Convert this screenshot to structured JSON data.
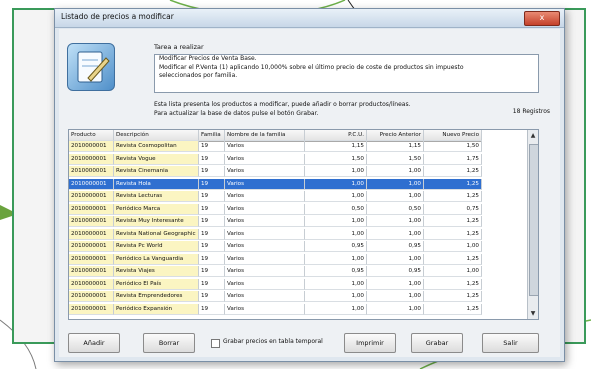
{
  "window": {
    "title": "Listado de precios a modificar",
    "close_glyph": "x"
  },
  "task": {
    "label": "Tarea a realizar",
    "lines": [
      "Modificar Precios de Venta Base.",
      "Modificar el P.Venta (1) aplicando 10,000% sobre el último precio de coste de productos sin impuesto",
      "seleccionados por familia."
    ],
    "icon": "notepad-pencil-icon"
  },
  "info": {
    "line1": "Esta lista presenta los productos a modificar, puede añadir o borrar productos/líneas.",
    "line2": "Para actualizar la base de datos pulse el botón Grabar.",
    "record_count": "18 Registros"
  },
  "table": {
    "columns": [
      "Producto",
      "Descripción",
      "Familia",
      "Nombre de la familia",
      "P.C.U.",
      "Precio Anterior",
      "Nuevo Precio"
    ],
    "rows": [
      [
        "2010000001",
        "Revista Cosmopolitan",
        "19",
        "Varios",
        "1,15",
        "1,15",
        "1,50"
      ],
      [
        "2010000001",
        "Revista Vogue",
        "19",
        "Varios",
        "1,50",
        "1,50",
        "1,75"
      ],
      [
        "2010000001",
        "Revista Cinemania",
        "19",
        "Varios",
        "1,00",
        "1,00",
        "1,25"
      ],
      [
        "2010000001",
        "Revista Hola",
        "19",
        "Varios",
        "1,00",
        "1,00",
        "1,25"
      ],
      [
        "2010000001",
        "Revista Lecturas",
        "19",
        "Varios",
        "1,00",
        "1,00",
        "1,25"
      ],
      [
        "2010000001",
        "Periódico Marca",
        "19",
        "Varios",
        "0,50",
        "0,50",
        "0,75"
      ],
      [
        "2010000001",
        "Revista Muy Interesante",
        "19",
        "Varios",
        "1,00",
        "1,00",
        "1,25"
      ],
      [
        "2010000001",
        "Revista National Geographic",
        "19",
        "Varios",
        "1,00",
        "1,00",
        "1,25"
      ],
      [
        "2010000001",
        "Revista Pc World",
        "19",
        "Varios",
        "0,95",
        "0,95",
        "1,00"
      ],
      [
        "2010000001",
        "Periódico La Vanguardia",
        "19",
        "Varios",
        "1,00",
        "1,00",
        "1,25"
      ],
      [
        "2010000001",
        "Revista Viajes",
        "19",
        "Varios",
        "0,95",
        "0,95",
        "1,00"
      ],
      [
        "2010000001",
        "Periódico El País",
        "19",
        "Varios",
        "1,00",
        "1,00",
        "1,25"
      ],
      [
        "2010000001",
        "Revista Emprendedores",
        "19",
        "Varios",
        "1,00",
        "1,00",
        "1,25"
      ],
      [
        "2010000001",
        "Periódico Expansión",
        "19",
        "Varios",
        "1,00",
        "1,00",
        "1,25"
      ]
    ],
    "selected_row": 3
  },
  "buttons": {
    "add": "Añadir",
    "delete": "Borrar",
    "temp_table": "Grabar precios en tabla temporal",
    "print": "Imprimir",
    "save": "Grabar",
    "exit": "Salir"
  },
  "colors": {
    "frame": "#3a9a5a",
    "selection": "#2f6fd0",
    "key_columns": "#fbf5c2"
  }
}
